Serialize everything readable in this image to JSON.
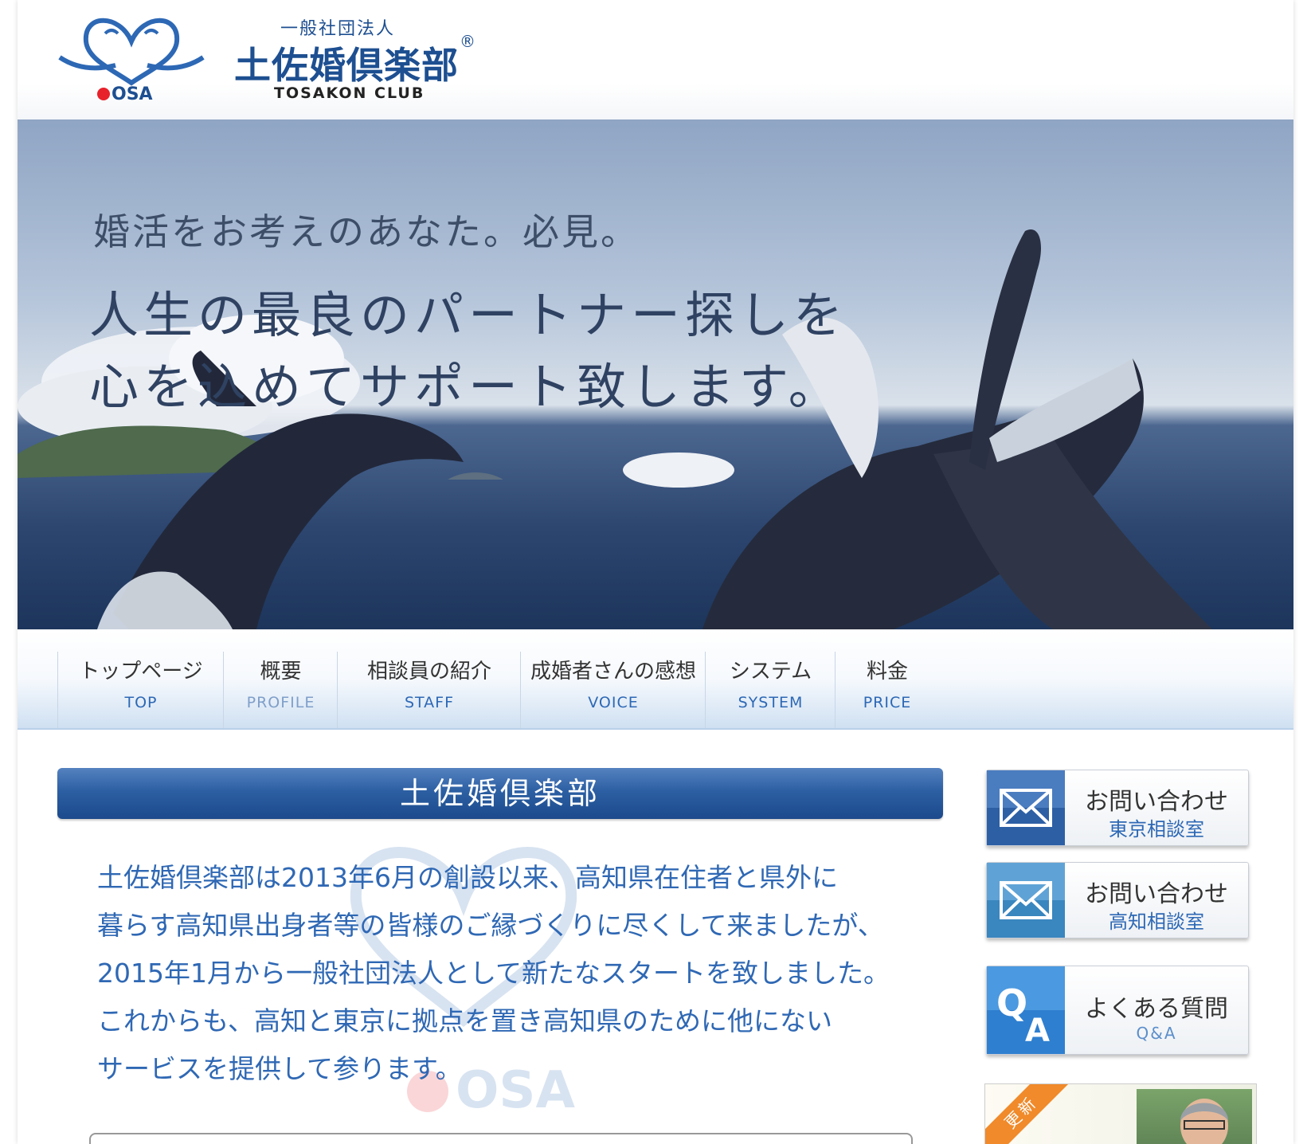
{
  "header": {
    "org_type": "一般社団法人",
    "site_name": "土佐婚倶楽部",
    "registered_mark": "®",
    "site_name_en": "TOSAKON CLUB",
    "logo_text": "OSA"
  },
  "hero": {
    "line1": "婚活をお考えのあなた。必見。",
    "line2": "人生の最良のパートナー探しを",
    "line3": "心を込めてサポート致します。"
  },
  "nav": [
    {
      "jp": "トップページ",
      "en": "TOP"
    },
    {
      "jp": "概要",
      "en": "PROFILE"
    },
    {
      "jp": "相談員の紹介",
      "en": "STAFF"
    },
    {
      "jp": "成婚者さんの感想",
      "en": "VOICE"
    },
    {
      "jp": "システム",
      "en": "SYSTEM"
    },
    {
      "jp": "料金",
      "en": "PRICE"
    }
  ],
  "section": {
    "title": "土佐婚倶楽部",
    "paragraph": [
      "土佐婚倶楽部は2013年6月の創設以来、高知県在住者と県外に",
      "暮らす高知県出身者等の皆様のご縁づくりに尽くして来ましたが、",
      "2015年1月から一般社団法人として新たなスタートを致しました。",
      "これからも、高知と東京に拠点を置き高知県のために他にない",
      "サービスを提供して参ります。"
    ]
  },
  "sidebar": {
    "contact_tokyo": {
      "main": "お問い合わせ",
      "sub": "東京相談室"
    },
    "contact_kochi": {
      "main": "お問い合わせ",
      "sub": "高知相談室"
    },
    "faq": {
      "main": "よくある質問",
      "sub": "Q&A",
      "icon_q": "Q",
      "icon_a": "A"
    },
    "update_badge": "更新"
  },
  "colors": {
    "brand_blue": "#1d4f91",
    "link_blue": "#2d68b5",
    "heading_bar": "#2c5fa3",
    "ribbon_orange": "#f08a2a"
  },
  "icons": {
    "mail": "envelope-icon",
    "qa": "qa-icon"
  }
}
